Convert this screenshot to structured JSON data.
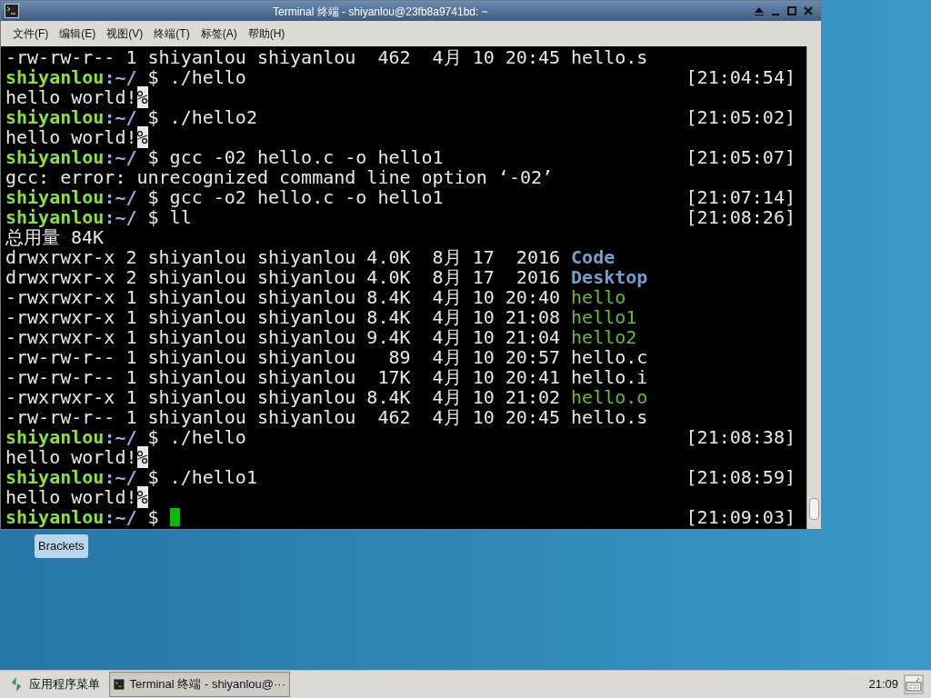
{
  "window": {
    "title": "Terminal 终端 - shiyanlou@23fb8a9741bd: ~"
  },
  "menu": [
    "文件(F)",
    "编辑(E)",
    "视图(V)",
    "终端(T)",
    "标签(A)",
    "帮助(H)"
  ],
  "terminal": {
    "lines": [
      {
        "segments": [
          {
            "text": "-rw-rw-r-- 1 shiyanlou shiyanlou  462  4月 10 20:45 hello.s",
            "kind": "plain"
          }
        ]
      },
      {
        "segments": [
          {
            "text": "shiyanlou",
            "kind": "user"
          },
          {
            "text": ":~/",
            "kind": "path"
          },
          {
            "text": " $ ./hello",
            "kind": "plain"
          }
        ],
        "time": "[21:04:54]"
      },
      {
        "segments": [
          {
            "text": "hello world!",
            "kind": "plain"
          },
          {
            "text": "%",
            "kind": "inverse"
          }
        ]
      },
      {
        "segments": [
          {
            "text": "shiyanlou",
            "kind": "user"
          },
          {
            "text": ":~/",
            "kind": "path"
          },
          {
            "text": " $ ./hello2",
            "kind": "plain"
          }
        ],
        "time": "[21:05:02]"
      },
      {
        "segments": [
          {
            "text": "hello world!",
            "kind": "plain"
          },
          {
            "text": "%",
            "kind": "inverse"
          }
        ]
      },
      {
        "segments": [
          {
            "text": "shiyanlou",
            "kind": "user"
          },
          {
            "text": ":~/",
            "kind": "path"
          },
          {
            "text": " $ gcc -02 hello.c -o hello1",
            "kind": "plain"
          }
        ],
        "time": "[21:05:07]"
      },
      {
        "segments": [
          {
            "text": "gcc: error: unrecognized command line option ‘-02’",
            "kind": "plain"
          }
        ]
      },
      {
        "segments": [
          {
            "text": "shiyanlou",
            "kind": "user"
          },
          {
            "text": ":~/",
            "kind": "path"
          },
          {
            "text": " $ gcc -o2 hello.c -o hello1",
            "kind": "plain"
          }
        ],
        "time": "[21:07:14]"
      },
      {
        "segments": [
          {
            "text": "shiyanlou",
            "kind": "user"
          },
          {
            "text": ":~/",
            "kind": "path"
          },
          {
            "text": " $ ll",
            "kind": "plain"
          }
        ],
        "time": "[21:08:26]"
      },
      {
        "segments": [
          {
            "text": "总用量 84K",
            "kind": "plain"
          }
        ]
      },
      {
        "segments": [
          {
            "text": "drwxrwxr-x 2 shiyanlou shiyanlou 4.0K  8月 17  2016 ",
            "kind": "plain"
          },
          {
            "text": "Code",
            "kind": "dir"
          }
        ]
      },
      {
        "segments": [
          {
            "text": "drwxrwxr-x 2 shiyanlou shiyanlou 4.0K  8月 17  2016 ",
            "kind": "plain"
          },
          {
            "text": "Desktop",
            "kind": "dir"
          }
        ]
      },
      {
        "segments": [
          {
            "text": "-rwxrwxr-x 1 shiyanlou shiyanlou 8.4K  4月 10 20:40 ",
            "kind": "plain"
          },
          {
            "text": "hello",
            "kind": "exec"
          }
        ]
      },
      {
        "segments": [
          {
            "text": "-rwxrwxr-x 1 shiyanlou shiyanlou 8.4K  4月 10 21:08 ",
            "kind": "plain"
          },
          {
            "text": "hello1",
            "kind": "exec"
          }
        ]
      },
      {
        "segments": [
          {
            "text": "-rwxrwxr-x 1 shiyanlou shiyanlou 9.4K  4月 10 21:04 ",
            "kind": "plain"
          },
          {
            "text": "hello2",
            "kind": "exec"
          }
        ]
      },
      {
        "segments": [
          {
            "text": "-rw-rw-r-- 1 shiyanlou shiyanlou   89  4月 10 20:57 hello.c",
            "kind": "plain"
          }
        ]
      },
      {
        "segments": [
          {
            "text": "-rw-rw-r-- 1 shiyanlou shiyanlou  17K  4月 10 20:41 hello.i",
            "kind": "plain"
          }
        ]
      },
      {
        "segments": [
          {
            "text": "-rwxrwxr-x 1 shiyanlou shiyanlou 8.4K  4月 10 21:02 ",
            "kind": "plain"
          },
          {
            "text": "hello.o",
            "kind": "exec"
          }
        ]
      },
      {
        "segments": [
          {
            "text": "-rw-rw-r-- 1 shiyanlou shiyanlou  462  4月 10 20:45 hello.s",
            "kind": "plain"
          }
        ]
      },
      {
        "segments": [
          {
            "text": "shiyanlou",
            "kind": "user"
          },
          {
            "text": ":~/",
            "kind": "path"
          },
          {
            "text": " $ ./hello",
            "kind": "plain"
          }
        ],
        "time": "[21:08:38]"
      },
      {
        "segments": [
          {
            "text": "hello world!",
            "kind": "plain"
          },
          {
            "text": "%",
            "kind": "inverse"
          }
        ]
      },
      {
        "segments": [
          {
            "text": "shiyanlou",
            "kind": "user"
          },
          {
            "text": ":~/",
            "kind": "path"
          },
          {
            "text": " $ ./hello1",
            "kind": "plain"
          }
        ],
        "time": "[21:08:59]"
      },
      {
        "segments": [
          {
            "text": "hello world!",
            "kind": "plain"
          },
          {
            "text": "%",
            "kind": "inverse"
          }
        ]
      },
      {
        "segments": [
          {
            "text": "shiyanlou",
            "kind": "user"
          },
          {
            "text": ":~/",
            "kind": "path"
          },
          {
            "text": " $ ",
            "kind": "plain"
          }
        ],
        "cursor": true,
        "time": "[21:09:03]"
      }
    ]
  },
  "desktop": {
    "icons": [
      {
        "label": "Brackets"
      }
    ]
  },
  "taskbar": {
    "app_menu": "应用程序菜单",
    "tasks": [
      {
        "label": "Terminal 终端 - shiyanlou@···",
        "selected": true
      }
    ],
    "clock": "21:09"
  }
}
